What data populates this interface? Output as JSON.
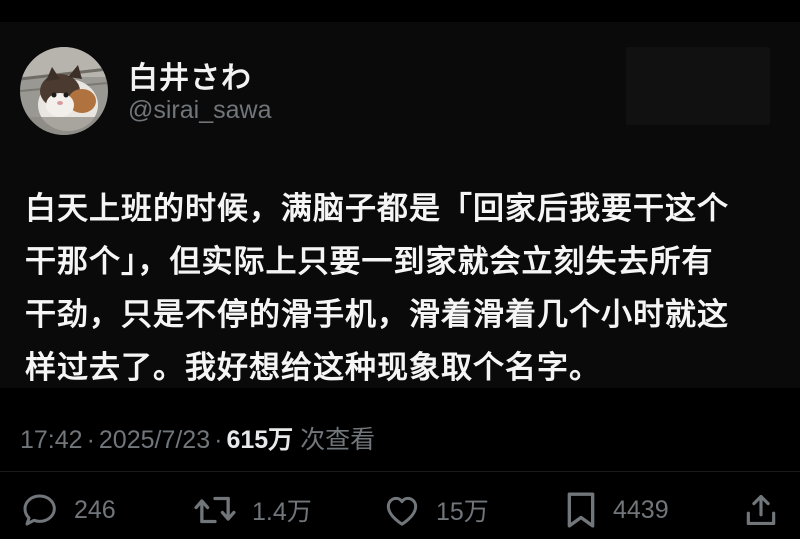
{
  "tweet": {
    "author": {
      "display_name": "白井さわ",
      "handle": "@sirai_sawa"
    },
    "text_lines": [
      "白天上班的时候，满脑子都是「回家后我要干这个",
      "干那个」，但实际上只要一到家就会立刻失去所有",
      "干劲，只是不停的滑手机，滑着滑着几个小时就这",
      "样过去了。我好想给这种现象取个名字。"
    ],
    "meta": {
      "time": "17:42",
      "separator": "·",
      "date": "2025/7/23",
      "views": "615万",
      "views_label": "次查看"
    },
    "actions": {
      "replies": "246",
      "retweets": "1.4万",
      "likes": "15万",
      "bookmarks": "4439"
    }
  },
  "icons": {
    "reply": "speech-bubble-icon",
    "retweet": "retweet-arrows-icon",
    "like": "heart-icon",
    "bookmark": "bookmark-icon",
    "share": "share-upload-icon"
  },
  "colors": {
    "background": "#000000",
    "text_primary": "#f5f5f5",
    "text_secondary": "#71767b"
  }
}
